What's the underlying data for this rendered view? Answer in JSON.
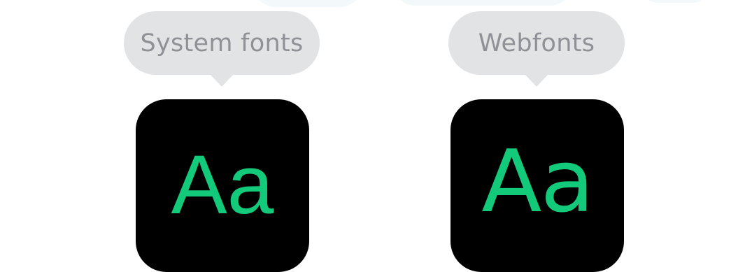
{
  "panels": [
    {
      "label": "System fonts",
      "sample": "Aa"
    },
    {
      "label": "Webfonts",
      "sample": "Aa"
    }
  ],
  "colors": {
    "background": "#ffffff",
    "bubble": "#e2e3e5",
    "bubble_text": "#8f9196",
    "tile": "#000000",
    "glyph": "#13c97a"
  }
}
